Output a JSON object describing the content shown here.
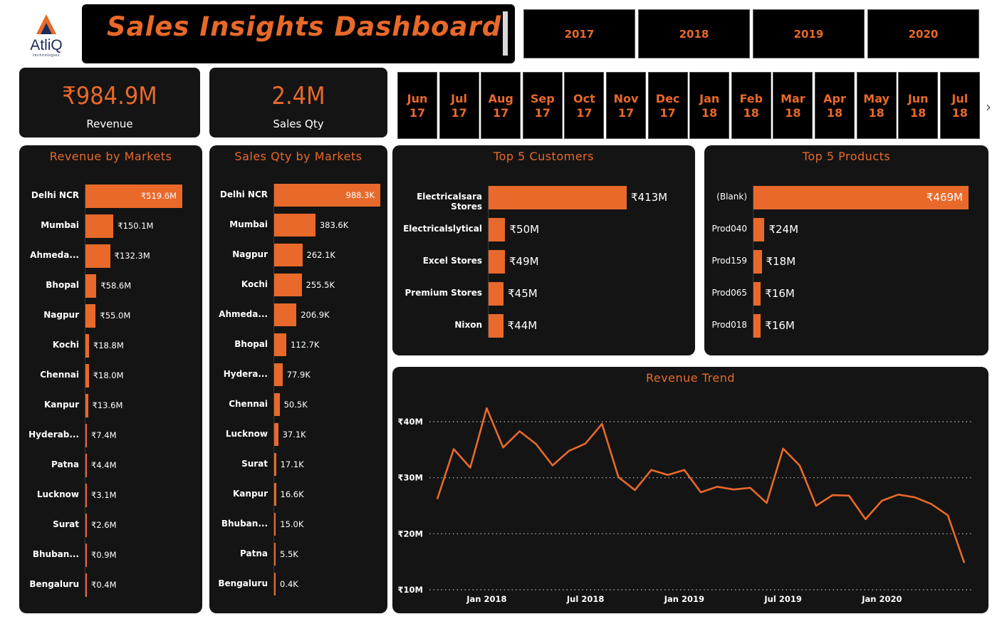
{
  "brand": {
    "name": "AtliQ",
    "tagline": "technologies"
  },
  "header": {
    "title": "Sales Insights Dashboard"
  },
  "years": [
    "2017",
    "2018",
    "2019",
    "2020"
  ],
  "months": [
    {
      "m": "Jun",
      "y": "17"
    },
    {
      "m": "Jul",
      "y": "17"
    },
    {
      "m": "Aug",
      "y": "17"
    },
    {
      "m": "Sep",
      "y": "17"
    },
    {
      "m": "Oct",
      "y": "17"
    },
    {
      "m": "Nov",
      "y": "17"
    },
    {
      "m": "Dec",
      "y": "17"
    },
    {
      "m": "Jan",
      "y": "18"
    },
    {
      "m": "Feb",
      "y": "18"
    },
    {
      "m": "Mar",
      "y": "18"
    },
    {
      "m": "Apr",
      "y": "18"
    },
    {
      "m": "May",
      "y": "18"
    },
    {
      "m": "Jun",
      "y": "18"
    },
    {
      "m": "Jul",
      "y": "18"
    }
  ],
  "kpis": {
    "revenue": {
      "value": "₹984.9M",
      "label": "Revenue"
    },
    "qty": {
      "value": "2.4M",
      "label": "Sales Qty"
    }
  },
  "colors": {
    "accent": "#e8692a",
    "panel": "#141414",
    "text": "#ffffff"
  },
  "icons": {
    "next": "chevron-right-icon",
    "logo": "atliq-logo-icon"
  },
  "chart_data": [
    {
      "id": "revenue-by-markets",
      "type": "bar",
      "orientation": "horizontal",
      "title": "Revenue by Markets",
      "categories": [
        "Delhi NCR",
        "Mumbai",
        "Ahmeda...",
        "Bhopal",
        "Nagpur",
        "Kochi",
        "Chennai",
        "Kanpur",
        "Hyderab...",
        "Patna",
        "Lucknow",
        "Surat",
        "Bhuban...",
        "Bengaluru"
      ],
      "values": [
        519.6,
        150.1,
        132.3,
        58.6,
        55.0,
        18.8,
        18.0,
        13.6,
        7.4,
        4.4,
        3.1,
        2.6,
        0.9,
        0.4
      ],
      "labels": [
        "₹519.6M",
        "₹150.1M",
        "₹132.3M",
        "₹58.6M",
        "₹55.0M",
        "₹18.8M",
        "₹18.0M",
        "₹13.6M",
        "₹7.4M",
        "₹4.4M",
        "₹3.1M",
        "₹2.6M",
        "₹0.9M",
        "₹0.4M"
      ],
      "xlim": [
        0,
        519.6
      ]
    },
    {
      "id": "qty-by-markets",
      "type": "bar",
      "orientation": "horizontal",
      "title": "Sales Qty by Markets",
      "categories": [
        "Delhi NCR",
        "Mumbai",
        "Nagpur",
        "Kochi",
        "Ahmeda...",
        "Bhopal",
        "Hydera...",
        "Chennai",
        "Lucknow",
        "Surat",
        "Kanpur",
        "Bhuban...",
        "Patna",
        "Bengaluru"
      ],
      "values": [
        988.3,
        383.6,
        262.1,
        255.5,
        206.9,
        112.7,
        77.9,
        50.5,
        37.1,
        17.1,
        16.6,
        15.0,
        5.5,
        0.4
      ],
      "labels": [
        "988.3K",
        "383.6K",
        "262.1K",
        "255.5K",
        "206.9K",
        "112.7K",
        "77.9K",
        "50.5K",
        "37.1K",
        "17.1K",
        "16.6K",
        "15.0K",
        "5.5K",
        "0.4K"
      ],
      "xlim": [
        0,
        988.3
      ]
    },
    {
      "id": "top-customers",
      "type": "bar",
      "orientation": "horizontal",
      "title": "Top 5 Customers",
      "categories": [
        "Electricalsara Stores",
        "Electricalslytical",
        "Excel Stores",
        "Premium Stores",
        "Nixon"
      ],
      "values": [
        413,
        50,
        49,
        45,
        44
      ],
      "labels": [
        "₹413M",
        "₹50M",
        "₹49M",
        "₹45M",
        "₹44M"
      ],
      "xlim": [
        0,
        413
      ]
    },
    {
      "id": "top-products",
      "type": "bar",
      "orientation": "horizontal",
      "title": "Top 5 Products",
      "categories": [
        "(Blank)",
        "Prod040",
        "Prod159",
        "Prod065",
        "Prod018"
      ],
      "values": [
        469,
        24,
        18,
        16,
        16
      ],
      "labels": [
        "₹469M",
        "₹24M",
        "₹18M",
        "₹16M",
        "₹16M"
      ],
      "xlim": [
        0,
        469
      ]
    },
    {
      "id": "revenue-trend",
      "type": "line",
      "title": "Revenue Trend",
      "x": [
        "2017-10",
        "2017-11",
        "2017-12",
        "2018-01",
        "2018-02",
        "2018-03",
        "2018-04",
        "2018-05",
        "2018-06",
        "2018-07",
        "2018-08",
        "2018-09",
        "2018-10",
        "2018-11",
        "2018-12",
        "2019-01",
        "2019-02",
        "2019-03",
        "2019-04",
        "2019-05",
        "2019-06",
        "2019-07",
        "2019-08",
        "2019-09",
        "2019-10",
        "2019-11",
        "2019-12",
        "2020-01",
        "2020-02",
        "2020-03",
        "2020-04",
        "2020-05",
        "2020-06"
      ],
      "values": [
        26.2,
        35.1,
        31.8,
        42.4,
        35.4,
        38.3,
        36.0,
        32.2,
        34.8,
        36.1,
        39.6,
        30.1,
        27.8,
        31.4,
        30.5,
        31.4,
        27.4,
        28.4,
        27.9,
        28.2,
        25.5,
        35.2,
        32.2,
        25.0,
        26.9,
        26.8,
        22.6,
        25.9,
        27.0,
        26.5,
        25.3,
        23.3,
        14.8
      ],
      "xticks": [
        "Jan 2018",
        "Jul 2018",
        "Jan 2019",
        "Jul 2019",
        "Jan 2020"
      ],
      "yticks": [
        "₹10M",
        "₹20M",
        "₹30M",
        "₹40M"
      ],
      "ylim": [
        10,
        43
      ],
      "grid": true
    }
  ]
}
